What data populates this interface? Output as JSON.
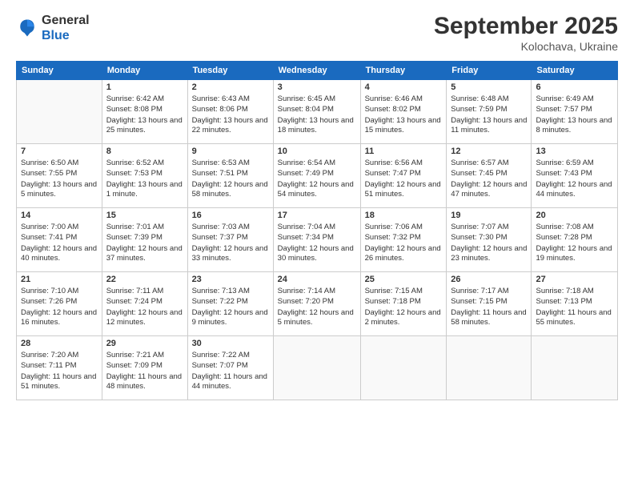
{
  "header": {
    "logo_general": "General",
    "logo_blue": "Blue",
    "month_title": "September 2025",
    "location": "Kolochava, Ukraine"
  },
  "days_of_week": [
    "Sunday",
    "Monday",
    "Tuesday",
    "Wednesday",
    "Thursday",
    "Friday",
    "Saturday"
  ],
  "weeks": [
    [
      {
        "day": "",
        "sunrise": "",
        "sunset": "",
        "daylight": ""
      },
      {
        "day": "1",
        "sunrise": "Sunrise: 6:42 AM",
        "sunset": "Sunset: 8:08 PM",
        "daylight": "Daylight: 13 hours and 25 minutes."
      },
      {
        "day": "2",
        "sunrise": "Sunrise: 6:43 AM",
        "sunset": "Sunset: 8:06 PM",
        "daylight": "Daylight: 13 hours and 22 minutes."
      },
      {
        "day": "3",
        "sunrise": "Sunrise: 6:45 AM",
        "sunset": "Sunset: 8:04 PM",
        "daylight": "Daylight: 13 hours and 18 minutes."
      },
      {
        "day": "4",
        "sunrise": "Sunrise: 6:46 AM",
        "sunset": "Sunset: 8:02 PM",
        "daylight": "Daylight: 13 hours and 15 minutes."
      },
      {
        "day": "5",
        "sunrise": "Sunrise: 6:48 AM",
        "sunset": "Sunset: 7:59 PM",
        "daylight": "Daylight: 13 hours and 11 minutes."
      },
      {
        "day": "6",
        "sunrise": "Sunrise: 6:49 AM",
        "sunset": "Sunset: 7:57 PM",
        "daylight": "Daylight: 13 hours and 8 minutes."
      }
    ],
    [
      {
        "day": "7",
        "sunrise": "Sunrise: 6:50 AM",
        "sunset": "Sunset: 7:55 PM",
        "daylight": "Daylight: 13 hours and 5 minutes."
      },
      {
        "day": "8",
        "sunrise": "Sunrise: 6:52 AM",
        "sunset": "Sunset: 7:53 PM",
        "daylight": "Daylight: 13 hours and 1 minute."
      },
      {
        "day": "9",
        "sunrise": "Sunrise: 6:53 AM",
        "sunset": "Sunset: 7:51 PM",
        "daylight": "Daylight: 12 hours and 58 minutes."
      },
      {
        "day": "10",
        "sunrise": "Sunrise: 6:54 AM",
        "sunset": "Sunset: 7:49 PM",
        "daylight": "Daylight: 12 hours and 54 minutes."
      },
      {
        "day": "11",
        "sunrise": "Sunrise: 6:56 AM",
        "sunset": "Sunset: 7:47 PM",
        "daylight": "Daylight: 12 hours and 51 minutes."
      },
      {
        "day": "12",
        "sunrise": "Sunrise: 6:57 AM",
        "sunset": "Sunset: 7:45 PM",
        "daylight": "Daylight: 12 hours and 47 minutes."
      },
      {
        "day": "13",
        "sunrise": "Sunrise: 6:59 AM",
        "sunset": "Sunset: 7:43 PM",
        "daylight": "Daylight: 12 hours and 44 minutes."
      }
    ],
    [
      {
        "day": "14",
        "sunrise": "Sunrise: 7:00 AM",
        "sunset": "Sunset: 7:41 PM",
        "daylight": "Daylight: 12 hours and 40 minutes."
      },
      {
        "day": "15",
        "sunrise": "Sunrise: 7:01 AM",
        "sunset": "Sunset: 7:39 PM",
        "daylight": "Daylight: 12 hours and 37 minutes."
      },
      {
        "day": "16",
        "sunrise": "Sunrise: 7:03 AM",
        "sunset": "Sunset: 7:37 PM",
        "daylight": "Daylight: 12 hours and 33 minutes."
      },
      {
        "day": "17",
        "sunrise": "Sunrise: 7:04 AM",
        "sunset": "Sunset: 7:34 PM",
        "daylight": "Daylight: 12 hours and 30 minutes."
      },
      {
        "day": "18",
        "sunrise": "Sunrise: 7:06 AM",
        "sunset": "Sunset: 7:32 PM",
        "daylight": "Daylight: 12 hours and 26 minutes."
      },
      {
        "day": "19",
        "sunrise": "Sunrise: 7:07 AM",
        "sunset": "Sunset: 7:30 PM",
        "daylight": "Daylight: 12 hours and 23 minutes."
      },
      {
        "day": "20",
        "sunrise": "Sunrise: 7:08 AM",
        "sunset": "Sunset: 7:28 PM",
        "daylight": "Daylight: 12 hours and 19 minutes."
      }
    ],
    [
      {
        "day": "21",
        "sunrise": "Sunrise: 7:10 AM",
        "sunset": "Sunset: 7:26 PM",
        "daylight": "Daylight: 12 hours and 16 minutes."
      },
      {
        "day": "22",
        "sunrise": "Sunrise: 7:11 AM",
        "sunset": "Sunset: 7:24 PM",
        "daylight": "Daylight: 12 hours and 12 minutes."
      },
      {
        "day": "23",
        "sunrise": "Sunrise: 7:13 AM",
        "sunset": "Sunset: 7:22 PM",
        "daylight": "Daylight: 12 hours and 9 minutes."
      },
      {
        "day": "24",
        "sunrise": "Sunrise: 7:14 AM",
        "sunset": "Sunset: 7:20 PM",
        "daylight": "Daylight: 12 hours and 5 minutes."
      },
      {
        "day": "25",
        "sunrise": "Sunrise: 7:15 AM",
        "sunset": "Sunset: 7:18 PM",
        "daylight": "Daylight: 12 hours and 2 minutes."
      },
      {
        "day": "26",
        "sunrise": "Sunrise: 7:17 AM",
        "sunset": "Sunset: 7:15 PM",
        "daylight": "Daylight: 11 hours and 58 minutes."
      },
      {
        "day": "27",
        "sunrise": "Sunrise: 7:18 AM",
        "sunset": "Sunset: 7:13 PM",
        "daylight": "Daylight: 11 hours and 55 minutes."
      }
    ],
    [
      {
        "day": "28",
        "sunrise": "Sunrise: 7:20 AM",
        "sunset": "Sunset: 7:11 PM",
        "daylight": "Daylight: 11 hours and 51 minutes."
      },
      {
        "day": "29",
        "sunrise": "Sunrise: 7:21 AM",
        "sunset": "Sunset: 7:09 PM",
        "daylight": "Daylight: 11 hours and 48 minutes."
      },
      {
        "day": "30",
        "sunrise": "Sunrise: 7:22 AM",
        "sunset": "Sunset: 7:07 PM",
        "daylight": "Daylight: 11 hours and 44 minutes."
      },
      {
        "day": "",
        "sunrise": "",
        "sunset": "",
        "daylight": ""
      },
      {
        "day": "",
        "sunrise": "",
        "sunset": "",
        "daylight": ""
      },
      {
        "day": "",
        "sunrise": "",
        "sunset": "",
        "daylight": ""
      },
      {
        "day": "",
        "sunrise": "",
        "sunset": "",
        "daylight": ""
      }
    ]
  ]
}
